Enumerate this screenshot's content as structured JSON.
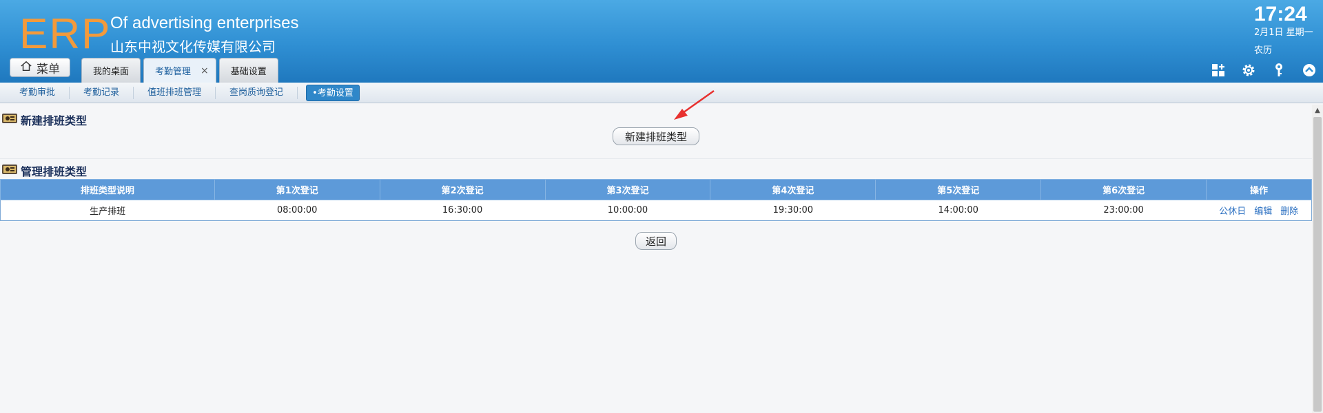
{
  "header": {
    "logo": "ERP",
    "brand_en": "Of advertising enterprises",
    "brand_cn": "山东中视文化传媒有限公司",
    "menu_label": "菜单",
    "tabs": [
      {
        "label": "我的桌面"
      },
      {
        "label": "考勤管理",
        "close": "×"
      },
      {
        "label": "基础设置"
      }
    ],
    "clock": "17:24",
    "date": "2月1日 星期一",
    "lunar": "农历"
  },
  "subnav": {
    "items": [
      "考勤审批",
      "考勤记录",
      "值班排班管理",
      "查岗质询登记",
      "•考勤设置"
    ]
  },
  "sections": {
    "new_title": "新建排班类型",
    "new_button": "新建排班类型",
    "manage_title": "管理排班类型",
    "back_button": "返回"
  },
  "table": {
    "headers": [
      "排班类型说明",
      "第1次登记",
      "第2次登记",
      "第3次登记",
      "第4次登记",
      "第5次登记",
      "第6次登记",
      "操作"
    ],
    "rows": [
      {
        "name": "生产排班",
        "times": [
          "08:00:00",
          "16:30:00",
          "10:00:00",
          "19:30:00",
          "14:00:00",
          "23:00:00"
        ],
        "actions": [
          "公休日",
          "编辑",
          "删除"
        ]
      }
    ]
  },
  "colors": {
    "header_blue": "#2f8fd3",
    "logo_orange": "#f39a3b",
    "table_header": "#5d9ad9",
    "link_blue": "#2a6fc1",
    "arrow_red": "#e8312f"
  },
  "icons": [
    "home-icon",
    "add-widget-icon",
    "gear-icon",
    "key-icon",
    "collapse-up-icon",
    "section-icon",
    "arrow-annotation"
  ]
}
